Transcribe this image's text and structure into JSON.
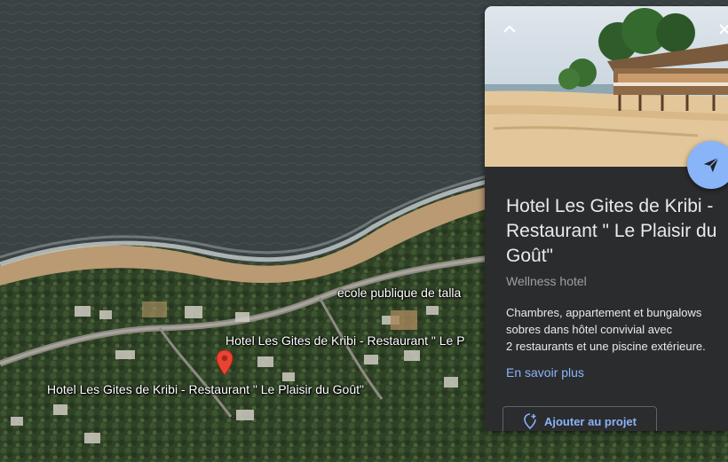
{
  "map": {
    "labels": {
      "school": "ecole publique de talla",
      "hotel_short": "Hotel Les Gites de Kribi - Restaurant \" Le P",
      "hotel_full": "Hotel Les Gites de Kribi - Restaurant \" Le Plaisir du Goût\""
    },
    "marker_icon": "map-pin-icon",
    "marker_color": "#ea4335"
  },
  "panel": {
    "title": "Hotel Les Gites de Kribi - Restaurant \" Le Plaisir du Goût\"",
    "category": "Wellness hotel",
    "description_lines": [
      "Chambres, appartement et bungalows",
      "sobres dans hôtel convivial avec",
      "2 restaurants et une piscine extérieure."
    ],
    "learn_more": "En savoir plus",
    "add_to_project": "Ajouter au projet",
    "icons": {
      "collapse": "chevron-up-icon",
      "close": "close-icon",
      "share": "send-icon",
      "add": "add-location-icon"
    },
    "colors": {
      "background": "#2b2c2e",
      "accent": "#8ab4f8",
      "text": "#e8eaed",
      "secondary": "#9aa0a6"
    }
  }
}
